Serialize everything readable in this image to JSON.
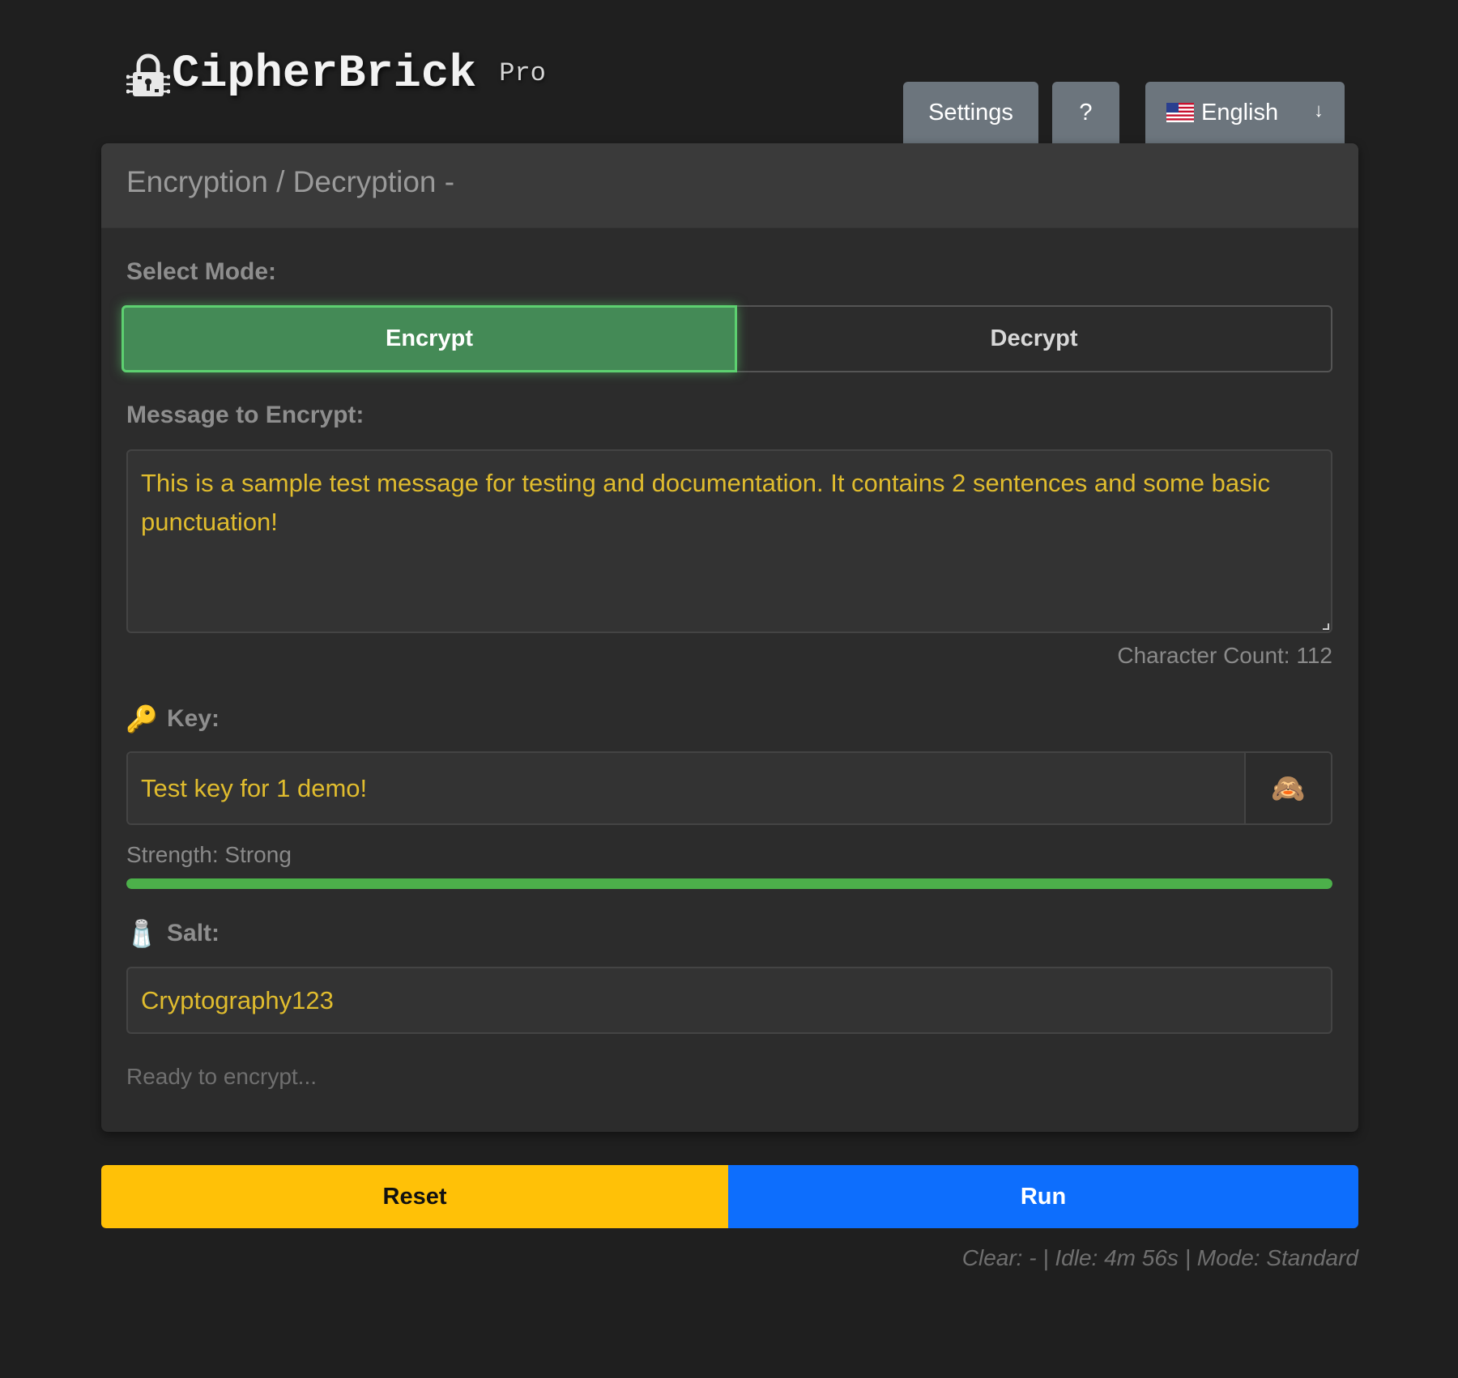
{
  "header": {
    "brand_name": "CipherBrick",
    "brand_tag": "Pro",
    "settings_label": "Settings",
    "help_label": "?",
    "language": {
      "selected": "English",
      "arrow": "↓"
    }
  },
  "card": {
    "title": "Encryption / Decryption -",
    "mode": {
      "label": "Select Mode:",
      "options": [
        "Encrypt",
        "Decrypt"
      ],
      "selected": "Encrypt"
    },
    "message": {
      "label": "Message to Encrypt:",
      "value": "This is a sample test message for testing and documentation. It contains 2 sentences and some basic punctuation!",
      "char_count": "Character Count: 112"
    },
    "key": {
      "emoji": "🔑",
      "label": "Key:",
      "value": "Test key for 1 demo!",
      "toggle_emoji": "🙈"
    },
    "strength": {
      "text": "Strength: Strong",
      "level_percent": 100
    },
    "salt": {
      "emoji": "🧂",
      "label": "Salt:",
      "value": "Cryptography123"
    },
    "status": "Ready to encrypt..."
  },
  "actions": {
    "reset_label": "Reset",
    "run_label": "Run"
  },
  "footer": {
    "status": "Clear: - | Idle: 4m 56s | Mode: Standard"
  },
  "colors": {
    "background": "#1f1f1f",
    "card": "#2c2c2c",
    "accent_green": "#448a56",
    "input_text": "#e0bc2e",
    "reset": "#ffc107",
    "run": "#0d6efd",
    "strength": "#4cb04a"
  },
  "icons": {
    "brand": "lock-circuit-icon",
    "flag": "us-flag-icon",
    "key": "key-icon",
    "salt": "salt-shaker-icon",
    "toggle": "see-no-evil-monkey-icon"
  }
}
